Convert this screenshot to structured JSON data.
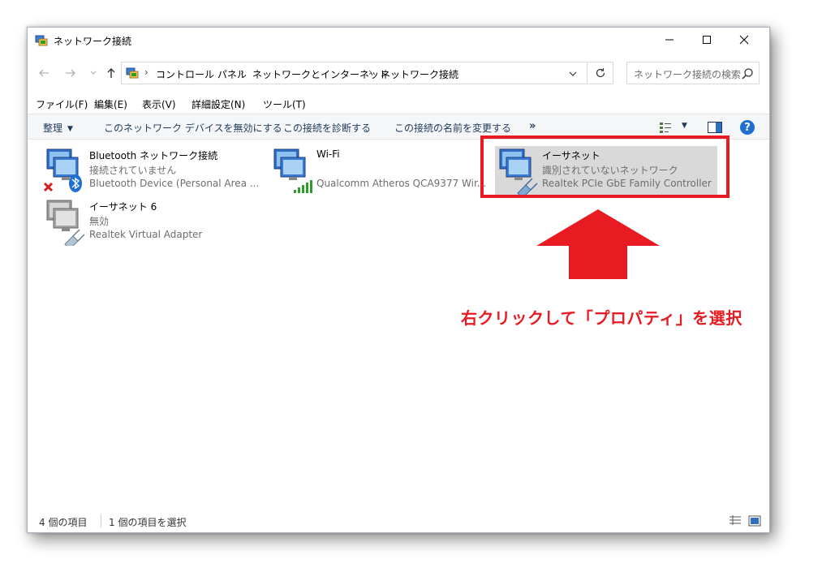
{
  "window": {
    "title": "ネットワーク接続"
  },
  "address": {
    "crumbs": [
      "コントロール パネル",
      "ネットワークとインターネット",
      "ネットワーク接続"
    ],
    "search_placeholder": "ネットワーク接続の検索"
  },
  "menu": [
    "ファイル(F)",
    "編集(E)",
    "表示(V)",
    "詳細設定(N)",
    "ツール(T)"
  ],
  "commands": {
    "organize": "整理",
    "disable": "このネットワーク デバイスを無効にする",
    "diagnose": "この接続を診断する",
    "rename": "この接続の名前を変更する",
    "more": "»"
  },
  "connections": [
    {
      "name": "Bluetooth ネットワーク接続",
      "status": "接続されていません",
      "device": "Bluetooth Device (Personal Area ..."
    },
    {
      "name": "Wi-Fi",
      "status": "",
      "device": "Qualcomm Atheros QCA9377 Wir..."
    },
    {
      "name": "イーサネット",
      "status": "識別されていないネットワーク",
      "device": "Realtek PCIe GbE Family Controller"
    },
    {
      "name": "イーサネット 6",
      "status": "無効",
      "device": "Realtek Virtual Adapter"
    }
  ],
  "statusbar": {
    "count": "4 個の項目",
    "selected": "1 個の項目を選択"
  },
  "annotation": {
    "text": "右クリックして「プロパティ」を選択"
  },
  "colors": {
    "accent": "#e81b23",
    "selection": "#d9d9d9",
    "command_text": "#1e395b"
  }
}
